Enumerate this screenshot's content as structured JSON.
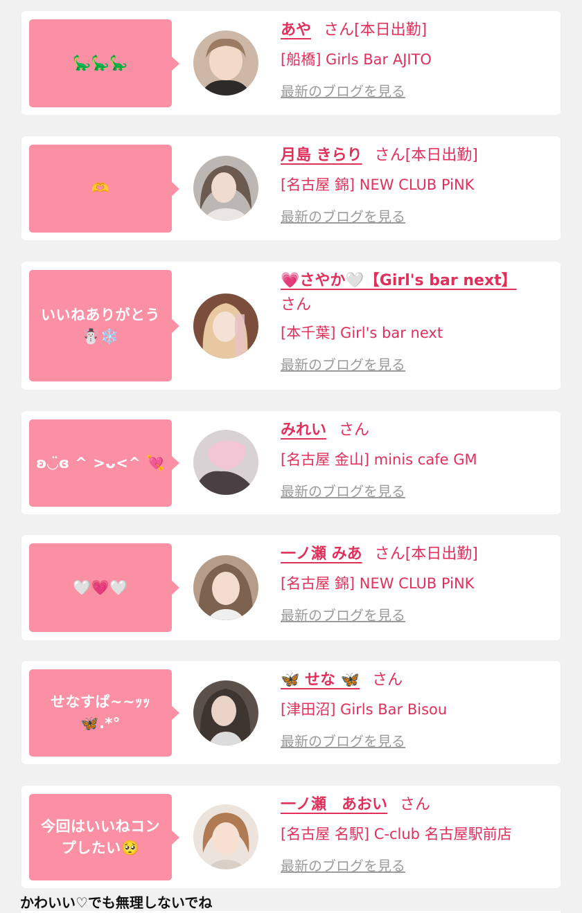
{
  "blog_link_label": "最新のブログを見る",
  "honorific": "さん",
  "colors": {
    "bubble": "#fb8fa3",
    "accent": "#e0305a",
    "link_gray": "#9b9b9b"
  },
  "cards": [
    {
      "message": "🦕🦕🦕",
      "name": "あや",
      "status": "[本日出勤]",
      "store": "[船橋] Girls Bar AJITO",
      "avatar_icon": "profile-photo"
    },
    {
      "message": "🫶",
      "name": "月島 きらり",
      "status": "[本日出勤]",
      "store": "[名古屋 錦] NEW CLUB PiNK",
      "avatar_icon": "profile-photo"
    },
    {
      "message": "いいねありがとう\n☃️❄️",
      "name": "💗さやか🤍【Girl's bar next】",
      "status": "",
      "store": "[本千葉] Girl's bar next",
      "avatar_icon": "profile-photo"
    },
    {
      "message": "ʚ◡̈ɞ ^ >ᴗ<^ 💘",
      "name": "みれい",
      "status": "",
      "store": "[名古屋 金山] minis cafe GM",
      "avatar_icon": "profile-photo"
    },
    {
      "message": "🤍💗🤍",
      "name": "一ノ瀬 みあ",
      "status": "[本日出勤]",
      "store": "[名古屋 錦] NEW CLUB PiNK",
      "avatar_icon": "profile-photo"
    },
    {
      "message": "せなすぱ~~ｯｯ\n🦋.*°",
      "name": "🦋 せな 🦋",
      "status": "",
      "store": "[津田沼] Girls Bar Bisou",
      "avatar_icon": "profile-photo"
    },
    {
      "message": "今回はいいねコン\nプしたい🥺",
      "name": "一ノ瀬　あおい",
      "status": "",
      "store": "[名古屋 名駅] C-club 名古屋駅前店",
      "avatar_icon": "profile-photo"
    }
  ],
  "footer_text": "かわいい♡でも無理しないでね"
}
